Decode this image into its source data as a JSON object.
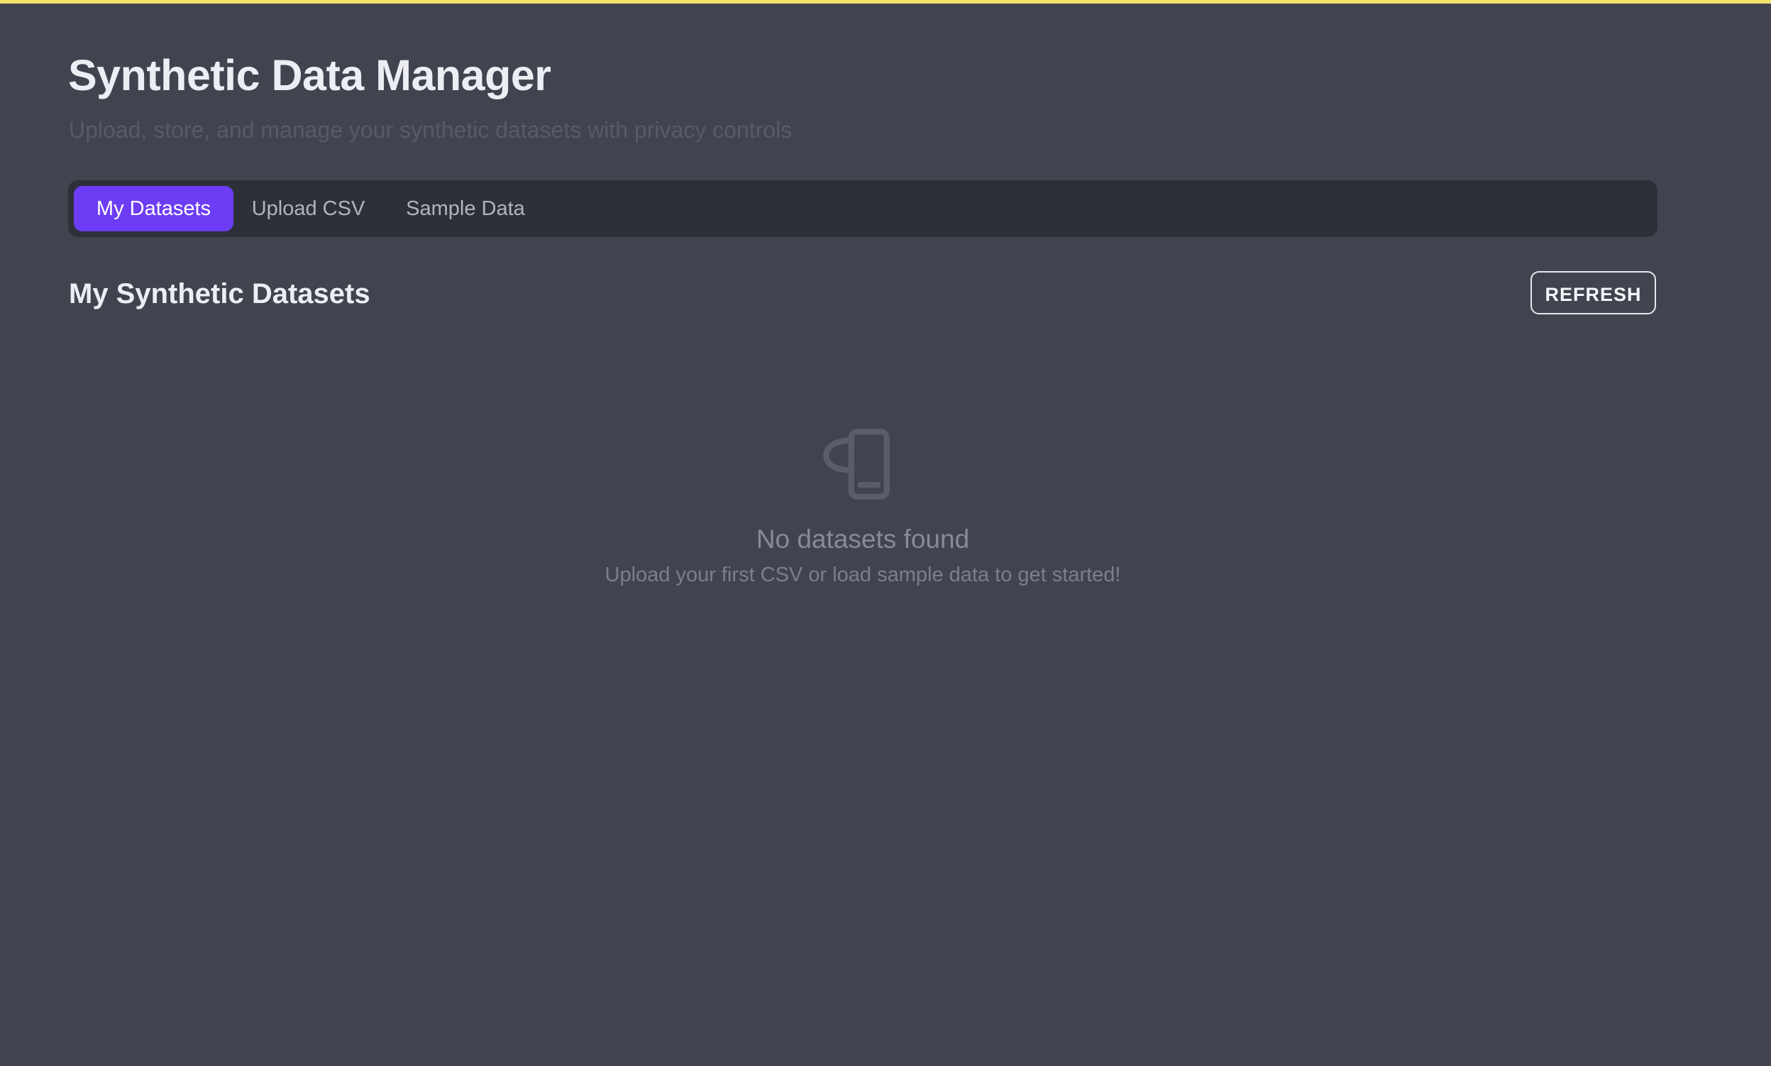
{
  "header": {
    "title": "Synthetic Data Manager",
    "subtitle": "Upload, store, and manage your synthetic datasets with privacy controls"
  },
  "tabs": [
    {
      "label": "My Datasets",
      "active": true
    },
    {
      "label": "Upload CSV",
      "active": false
    },
    {
      "label": "Sample Data",
      "active": false
    }
  ],
  "section": {
    "title": "My Synthetic Datasets",
    "refresh_label": "REFRESH"
  },
  "empty_state": {
    "icon": "dataset-icon",
    "title": "No datasets found",
    "message": "Upload your first CSV or load sample data to get started!"
  },
  "colors": {
    "background": "#41444f",
    "accent": "#6c3df4",
    "top_accent": "#f3e36f",
    "tab_bar": "#2e3039"
  }
}
